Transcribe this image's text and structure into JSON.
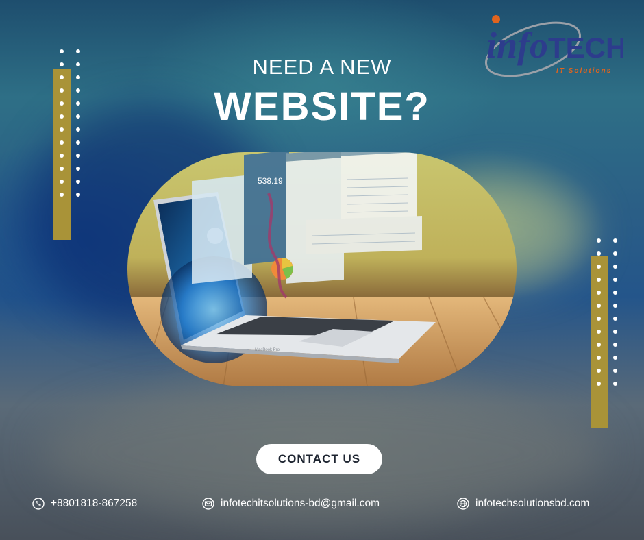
{
  "headline": {
    "line1": "NEED A NEW",
    "line2": "WEBSITE?"
  },
  "brand": {
    "logo_info": "info",
    "logo_tech": "TECH",
    "tagline": "IT Solutions",
    "colors": {
      "blue": "#2d3c8c",
      "orange": "#e0641e",
      "gold": "#a99338"
    }
  },
  "hero": {
    "ticker_value": "538.19",
    "laptop_badge": "MacBook Pro"
  },
  "cta": {
    "label": "CONTACT US"
  },
  "contacts": {
    "phone": {
      "icon": "phone-icon",
      "text": "+8801818-867258"
    },
    "email": {
      "icon": "mail-icon",
      "text": "infotechitsolutions-bd@gmail.com"
    },
    "web": {
      "icon": "globe-icon",
      "text": "infotechsolutionsbd.com"
    }
  }
}
